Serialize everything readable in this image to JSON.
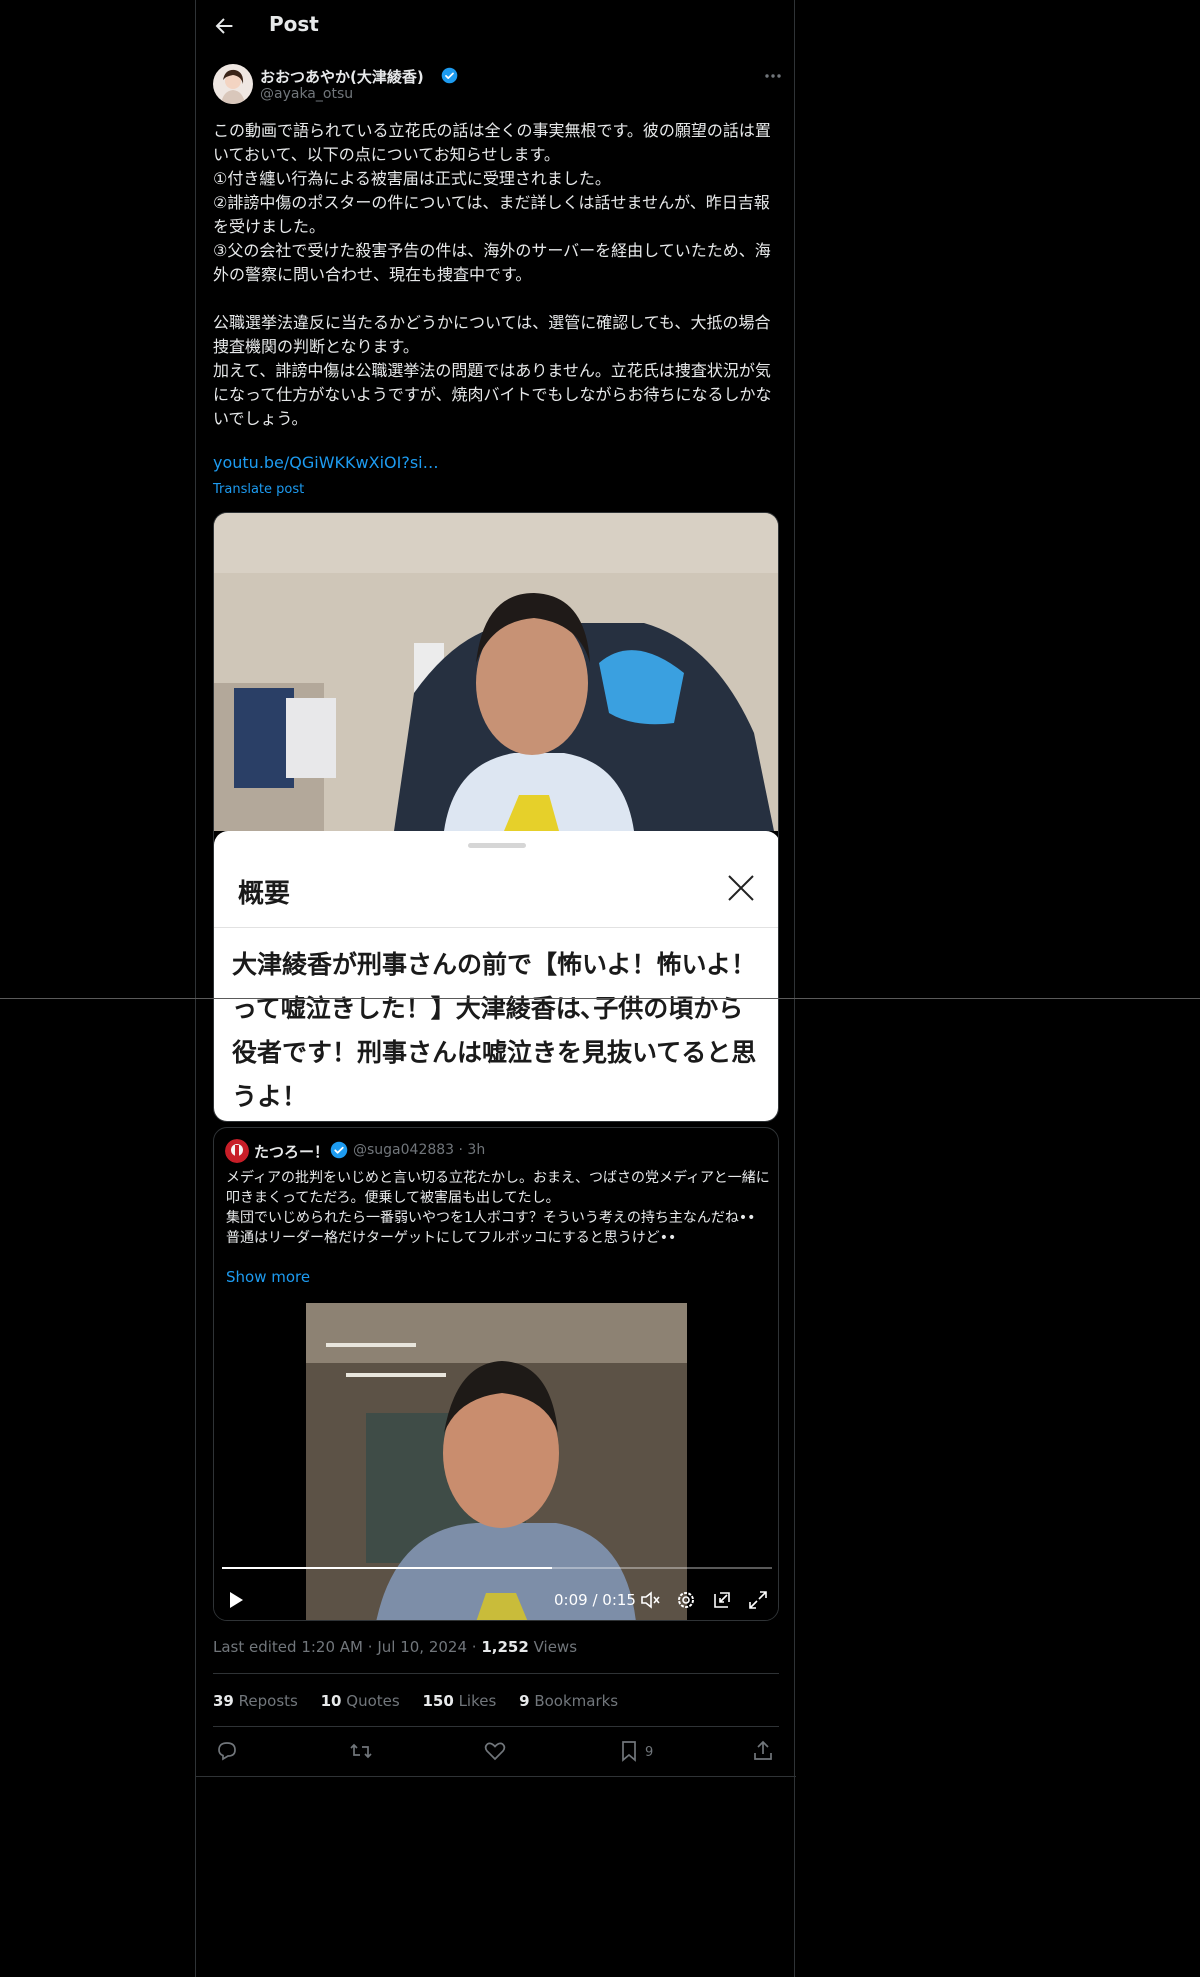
{
  "header": {
    "title": "Post"
  },
  "post": {
    "display_name": "おおつあやか(大津綾香)",
    "handle": "@ayaka_otsu",
    "text": "この動画で語られている立花氏の話は全くの事実無根です。彼の願望の話は置いておいて、以下の点についてお知らせします。\n①付き纏い行為による被害届は正式に受理されました。\n②誹謗中傷のポスターの件については、まだ詳しくは話せませんが、昨日吉報を受けました。\n③父の会社で受けた殺害予告の件は、海外のサーバーを経由していたため、海外の警察に問い合わせ、現在も捜査中です。\n\n公職選挙法違反に当たるかどうかについては、選管に確認しても、大抵の場合捜査機関の判断となります。\n加えて、誹謗中傷は公職選挙法の問題ではありません。立花氏は捜査状況が気になって仕方がないようですが、焼肉バイトでもしながらお待ちになるしかないでしょう。",
    "link": "youtu.be/QGiWKKwXiOI?si…",
    "translate": "Translate post"
  },
  "media_sheet": {
    "title": "概要",
    "text": "大津綾香が刑事さんの前で【怖いよ！怖いよ！って嘘泣きした！】大津綾香は､子供の頃から役者です！刑事さんは嘘泣きを見抜いてると思うよ！"
  },
  "quote": {
    "display_name": "たつろー！",
    "handle": "@suga042883",
    "time": "· 3h",
    "text": "メディアの批判をいじめと言い切る立花たかし。おまえ、つばさの党メディアと一緒に叩きまくってただろ。便乗して被害届も出してたし。\n集団でいじめられたら一番弱いやつを1人ボコす？そういう考えの持ち主なんだね••\n普通はリーダー格だけターゲットにしてフルボッコにすると思うけど••",
    "show_more": "Show more",
    "video": {
      "timecode": "0:09 / 0:15",
      "progress": 0.6
    }
  },
  "meta": {
    "edited": "Last edited 1:20 AM",
    "date": "Jul 10, 2024",
    "views_count": "1,252",
    "views_label": "Views",
    "sep": "·"
  },
  "stats": [
    {
      "count": "39",
      "label": "Reposts"
    },
    {
      "count": "10",
      "label": "Quotes"
    },
    {
      "count": "150",
      "label": "Likes"
    },
    {
      "count": "9",
      "label": "Bookmarks"
    }
  ],
  "actions": {
    "bookmark_count": "9"
  },
  "colors": {
    "accent": "#1d9bf0",
    "muted": "#71767b",
    "text": "#e7e9ea",
    "border": "#2f3336",
    "background": "#000000"
  }
}
